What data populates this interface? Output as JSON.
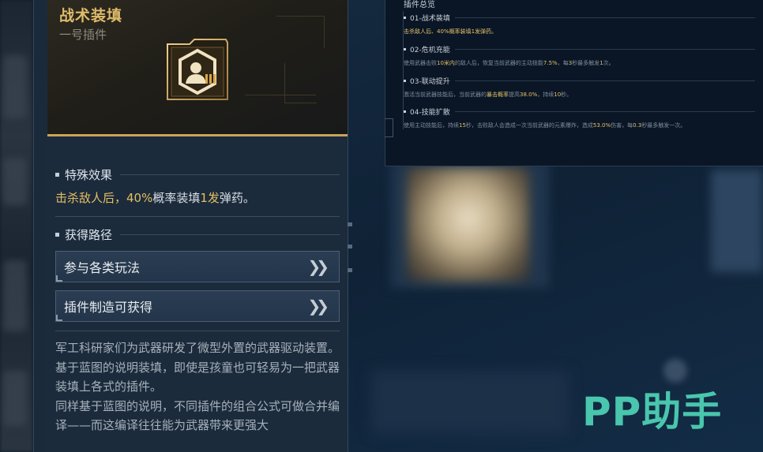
{
  "plugin": {
    "title": "战术装填",
    "subtitle": "一号插件",
    "icon": "tactical-reload-plugin-icon"
  },
  "special_effect": {
    "heading": "特殊效果",
    "text_parts": [
      {
        "text": "击杀敌人后，",
        "highlight": true
      },
      {
        "text": "40%",
        "highlight": true
      },
      {
        "text": "概率装填",
        "highlight": false
      },
      {
        "text": "1发",
        "highlight": true
      },
      {
        "text": "弹药。",
        "highlight": false
      }
    ]
  },
  "acquire": {
    "heading": "获得路径",
    "routes": [
      {
        "label": "参与各类玩法",
        "icon": "double-chevron-right-icon"
      },
      {
        "label": "插件制造可获得",
        "icon": "double-chevron-right-icon"
      }
    ]
  },
  "lore": [
    "军工科研家们为武器研发了微型外置的武器驱动装置。",
    "基于蓝图的说明装填，即使是孩童也可轻易为一把武器装填上各式的插件。",
    "同样基于蓝图的说明，不同插件的组合公式可做合并编译——而这编译往往能为武器带来更强大"
  ],
  "overview": {
    "title": "插件总览",
    "items": [
      {
        "name": "01-战术装填",
        "parts": [
          {
            "text": "击杀敌人后、",
            "hl": true
          },
          {
            "text": "40%",
            "hl": true
          },
          {
            "text": "概率装填",
            "hl": false
          },
          {
            "text": "1发",
            "hl": true
          },
          {
            "text": "弹药。",
            "hl": false
          }
        ]
      },
      {
        "name": "02-危机充能",
        "parts": [
          {
            "text": "使用武器击败",
            "hl": false
          },
          {
            "text": "10米内",
            "hl": true
          },
          {
            "text": "的敌人后，恢复当前武器的主动技能",
            "hl": false
          },
          {
            "text": "7.5%",
            "hl": true
          },
          {
            "text": "，每",
            "hl": false
          },
          {
            "text": "3",
            "hl": true
          },
          {
            "text": "秒最多触发",
            "hl": false
          },
          {
            "text": "1",
            "hl": true
          },
          {
            "text": "次。",
            "hl": false
          }
        ]
      },
      {
        "name": "03-联动提升",
        "parts": [
          {
            "text": "激活当前武器技能后，当前武器的",
            "hl": false
          },
          {
            "text": "暴击概率",
            "hl": true
          },
          {
            "text": "提高",
            "hl": false
          },
          {
            "text": "38.0%",
            "hl": true
          },
          {
            "text": "，持续",
            "hl": false
          },
          {
            "text": "10",
            "hl": true
          },
          {
            "text": "秒。",
            "hl": false
          }
        ]
      },
      {
        "name": "04-技能扩散",
        "parts": [
          {
            "text": "使用主动技能后，持续",
            "hl": false
          },
          {
            "text": "15",
            "hl": true
          },
          {
            "text": "秒，击败敌人会造成一次当前武器的元素爆炸，造成",
            "hl": false
          },
          {
            "text": "53.0%",
            "hl": true
          },
          {
            "text": "伤害，每",
            "hl": false
          },
          {
            "text": "0.3",
            "hl": true
          },
          {
            "text": "秒最多触发一次。",
            "hl": false
          }
        ]
      }
    ]
  },
  "watermark": "PP助手",
  "colors": {
    "gold": "#e0bc6a",
    "panel": "#1a2a3b",
    "watermark": "#49c6ad"
  }
}
